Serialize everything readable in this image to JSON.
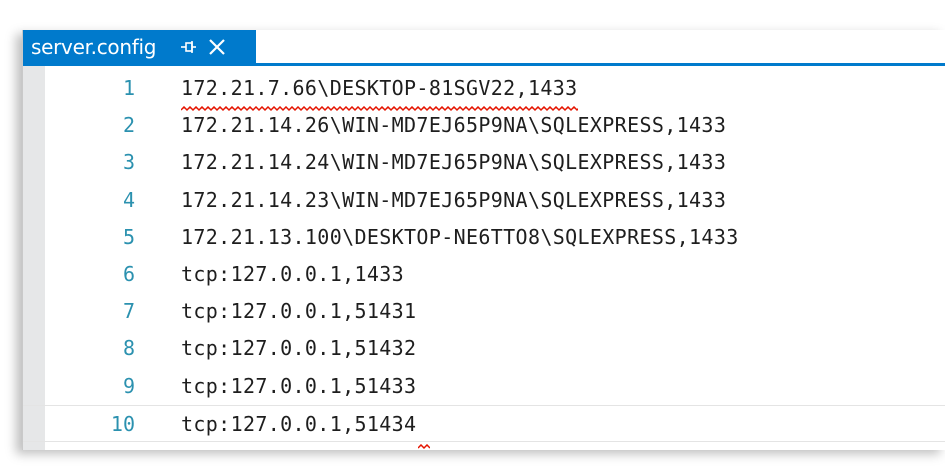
{
  "tab": {
    "title": "server.config",
    "pin_icon": "pin-icon",
    "close_icon": "close-icon",
    "active_color": "#007acc"
  },
  "editor": {
    "line_number_color": "#2b91af",
    "text_color": "#1e1e1e",
    "error_squiggle_color": "#e51400",
    "current_line": 10,
    "lines": [
      {
        "number": "1",
        "text": "172.21.7.66\\DESKTOP-81SGV22,1433",
        "error_underline": true
      },
      {
        "number": "2",
        "text": "172.21.14.26\\WIN-MD7EJ65P9NA\\SQLEXPRESS,1433"
      },
      {
        "number": "3",
        "text": "172.21.14.24\\WIN-MD7EJ65P9NA\\SQLEXPRESS,1433"
      },
      {
        "number": "4",
        "text": "172.21.14.23\\WIN-MD7EJ65P9NA\\SQLEXPRESS,1433"
      },
      {
        "number": "5",
        "text": "172.21.13.100\\DESKTOP-NE6TTO8\\SQLEXPRESS,1433"
      },
      {
        "number": "6",
        "text": "tcp:127.0.0.1,1433"
      },
      {
        "number": "7",
        "text": "tcp:127.0.0.1,51431"
      },
      {
        "number": "8",
        "text": "tcp:127.0.0.1,51432"
      },
      {
        "number": "9",
        "text": "tcp:127.0.0.1,51433"
      },
      {
        "number": "10",
        "text": "tcp:127.0.0.1,51434",
        "end_error_marker": true
      }
    ]
  }
}
